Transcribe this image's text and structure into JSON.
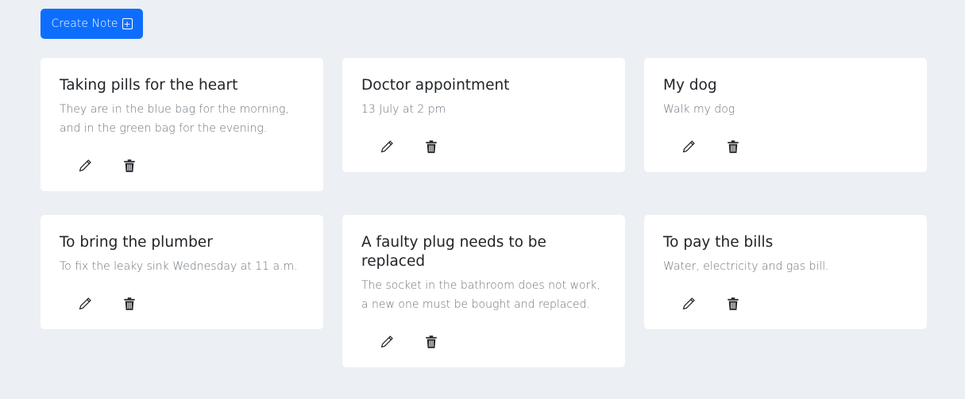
{
  "toolbar": {
    "create_label": "Create Note",
    "create_icon": "plus-square-icon"
  },
  "colors": {
    "background": "#eceff4",
    "accent": "#0d6efd",
    "card": "#ffffff",
    "title": "#212529",
    "body": "#6c757d"
  },
  "notes": [
    {
      "title": "Taking pills for the heart",
      "text": "They are in the blue bag for the morning, and in the green bag for the evening."
    },
    {
      "title": "Doctor appointment",
      "text": "13 July at 2 pm"
    },
    {
      "title": "My dog",
      "text": "Walk my dog"
    },
    {
      "title": "To bring the plumber",
      "text": "To fix the leaky sink Wednesday at 11 a.m."
    },
    {
      "title": "A faulty plug needs to be replaced",
      "text": "The socket in the bathroom does not work, a new one must be bought and replaced."
    },
    {
      "title": "To pay the bills",
      "text": "Water, electricity and gas bill."
    }
  ],
  "icons": {
    "edit": "pencil-icon",
    "delete": "trash-icon"
  }
}
